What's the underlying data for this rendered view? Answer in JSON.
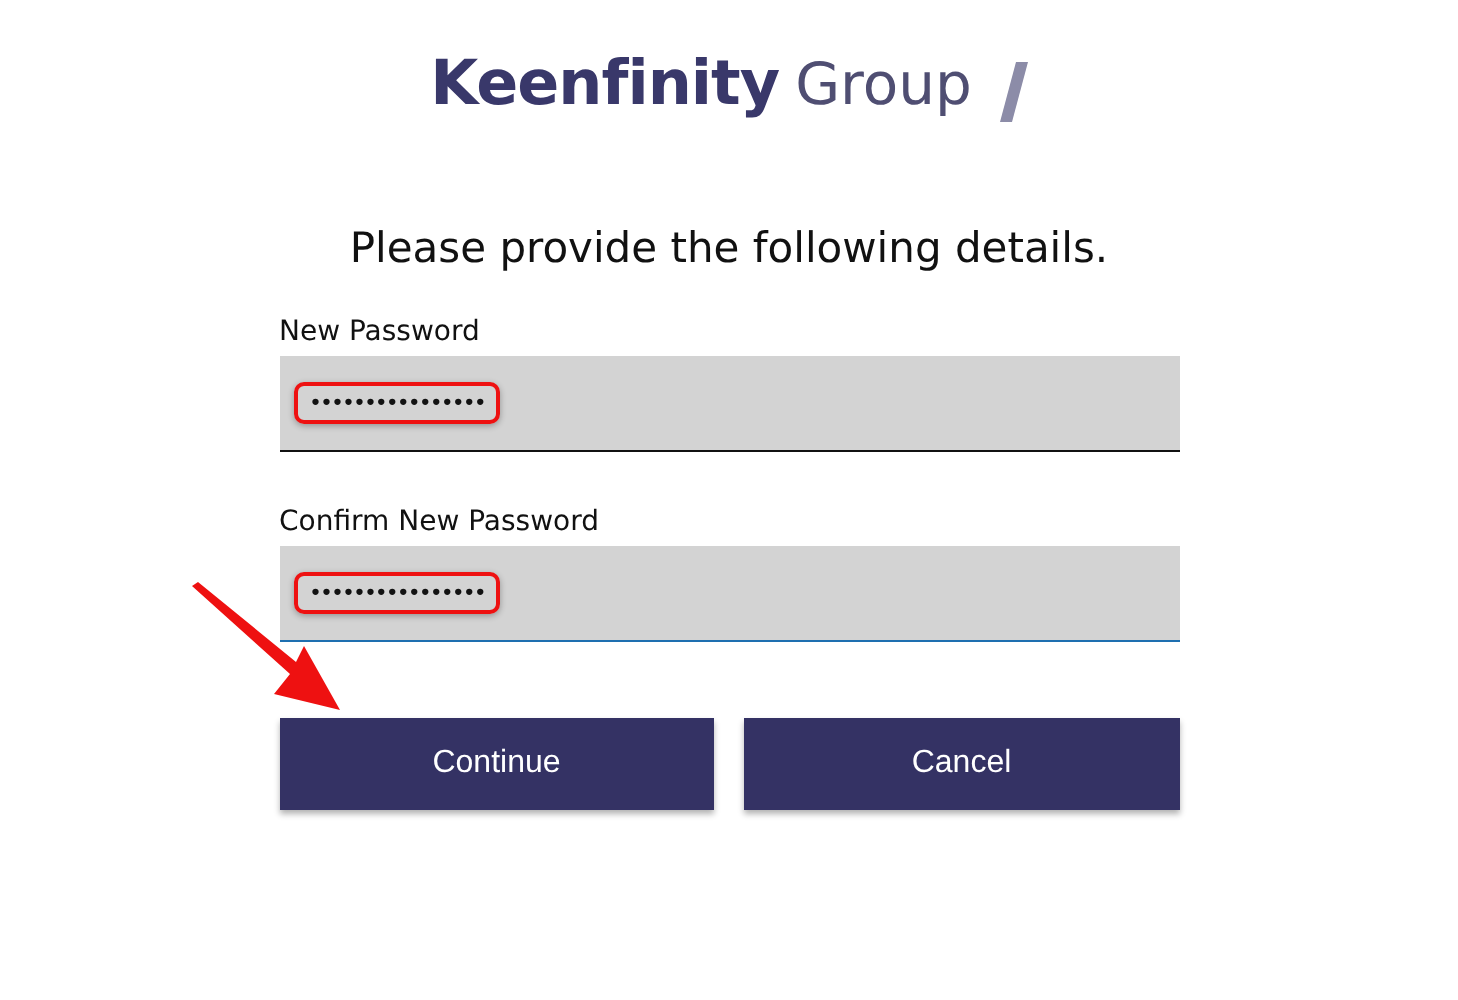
{
  "logo": {
    "brand": "Keenfinity",
    "suffix": "Group"
  },
  "heading": "Please provide the following details.",
  "fields": [
    {
      "label": "New Password",
      "value": "••••••••••••••••",
      "focused": false,
      "highlighted": true
    },
    {
      "label": "Confirm New Password",
      "value": "••••••••••••••••",
      "focused": true,
      "highlighted": true
    }
  ],
  "buttons": [
    {
      "label": "Continue"
    },
    {
      "label": "Cancel"
    }
  ],
  "annotations": [
    {
      "kind": "arrow"
    }
  ]
}
